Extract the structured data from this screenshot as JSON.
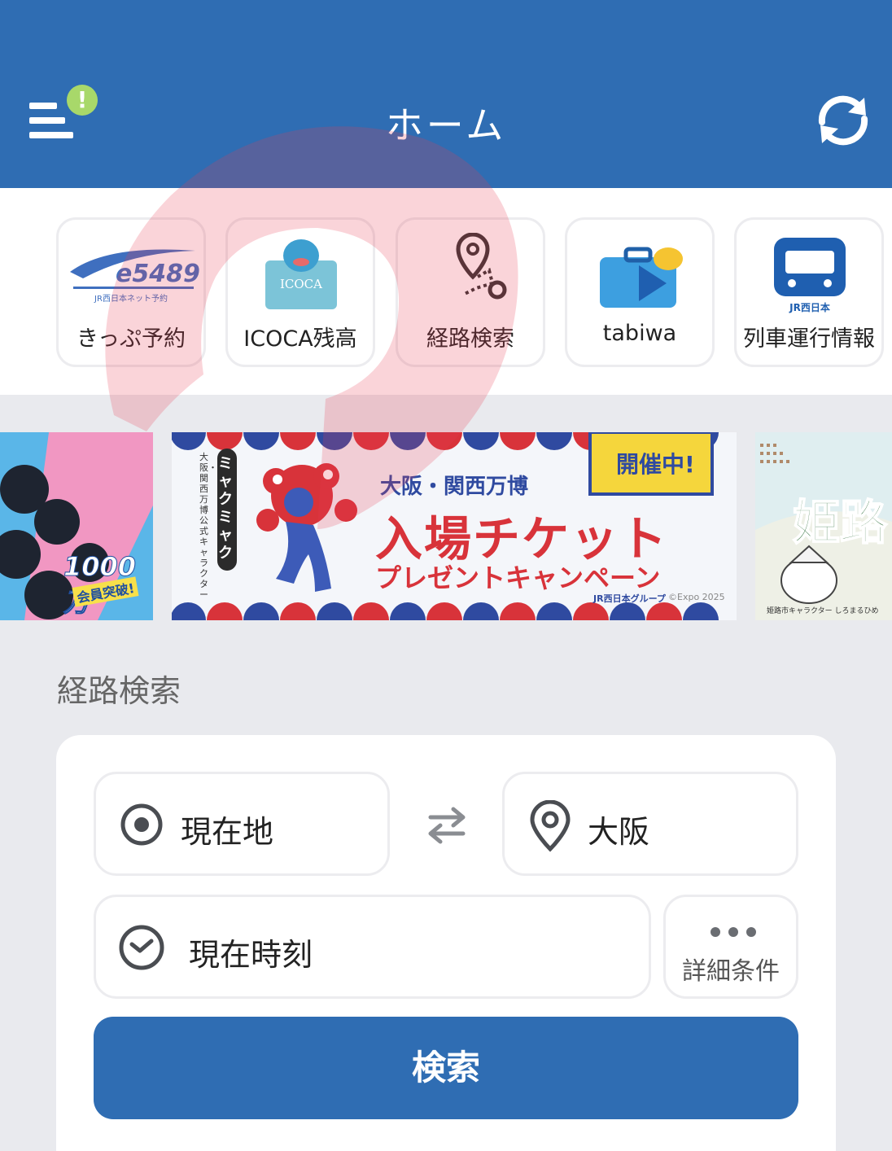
{
  "header": {
    "title": "ホーム",
    "menu_icon": "menu-icon",
    "alert_badge": "!",
    "refresh_icon": "refresh-icon"
  },
  "quick_menu": [
    {
      "id": "e5489",
      "icon": "e5489-logo",
      "logo_text": "e5489",
      "logo_sub": "JR西日本ネット予約",
      "label": "きっぷ予約"
    },
    {
      "id": "icoca",
      "icon": "icoca-card-icon",
      "logo_text": "ICOCA",
      "label": "ICOCA残高"
    },
    {
      "id": "route",
      "icon": "route-search-icon",
      "label": "経路検索"
    },
    {
      "id": "tabiwa",
      "icon": "suitcase-icon",
      "label": "tabiwa"
    },
    {
      "id": "train",
      "icon": "train-icon",
      "logo_text": "JR西日本",
      "label": "列車運行情報"
    }
  ],
  "banners": {
    "left": {
      "badge": "1000万",
      "sub": "会員突破!"
    },
    "center": {
      "badge": "開催中!",
      "vertical_a": "ミャクミャク",
      "vertical_b": "大阪・関西万博公式キャラクター",
      "headline_small": "大阪・関西万博",
      "headline_large": "入場チケット",
      "headline_sub": "プレゼントキャンペーン",
      "footer_brand": "JR西日本グループ",
      "footer_copy": "©Expo 2025"
    },
    "right": {
      "headline": "姫路",
      "caption": "姫路市キャラクター しろまるひめ"
    }
  },
  "route_search": {
    "section_title": "経路検索",
    "origin": "現在地",
    "destination": "大阪",
    "time": "現在時刻",
    "detail_label": "詳細条件",
    "search_label": "検索",
    "colors": {
      "accent": "#2f6db3",
      "icon": "#4a4d52"
    }
  }
}
